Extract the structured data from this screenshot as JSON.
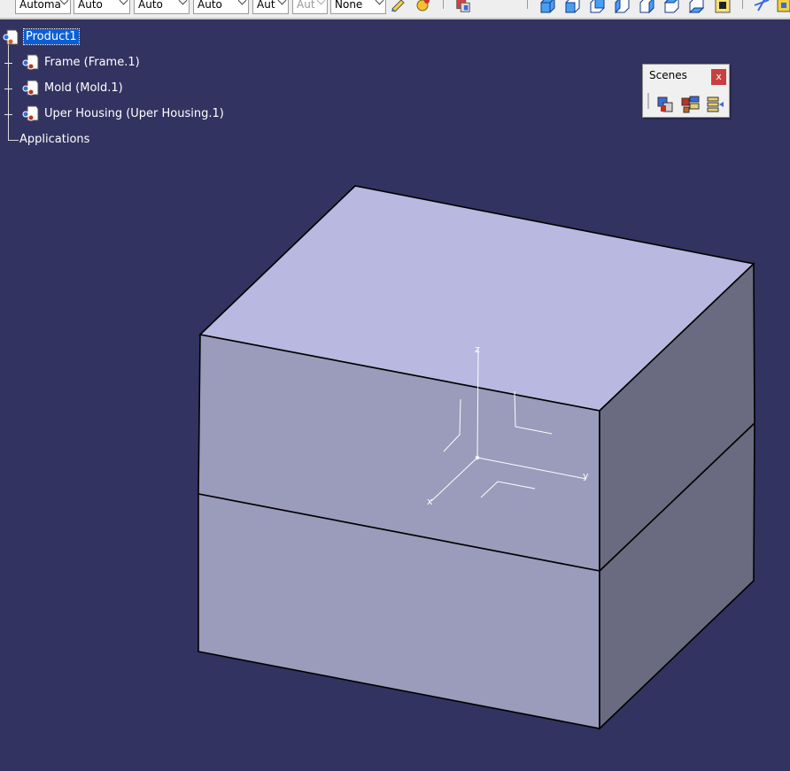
{
  "toolbar": {
    "combos": [
      {
        "value": "Automa",
        "disabled": false
      },
      {
        "value": "Auto",
        "disabled": false
      },
      {
        "value": "Auto",
        "disabled": false
      },
      {
        "value": "Auto",
        "disabled": false
      },
      {
        "value": "Aut",
        "disabled": false
      },
      {
        "value": "Aut",
        "disabled": true
      },
      {
        "value": "None",
        "disabled": false
      }
    ]
  },
  "tree": {
    "root": {
      "label": "Product1"
    },
    "children": [
      {
        "label": "Frame (Frame.1)"
      },
      {
        "label": "Mold (Mold.1)"
      },
      {
        "label": "Uper Housing (Uper Housing.1)"
      }
    ],
    "applications": {
      "label": "Applications"
    }
  },
  "scenes": {
    "title": "Scenes",
    "close_label": "x"
  },
  "axis": {
    "x_label": "x",
    "y_label": "y",
    "z_label": "z"
  },
  "colors": {
    "background": "#333361",
    "top_face": "#b8b8e0",
    "front_face": "#9b9bbb",
    "side_face": "#6a6a80",
    "selection": "#0a5fd6"
  }
}
